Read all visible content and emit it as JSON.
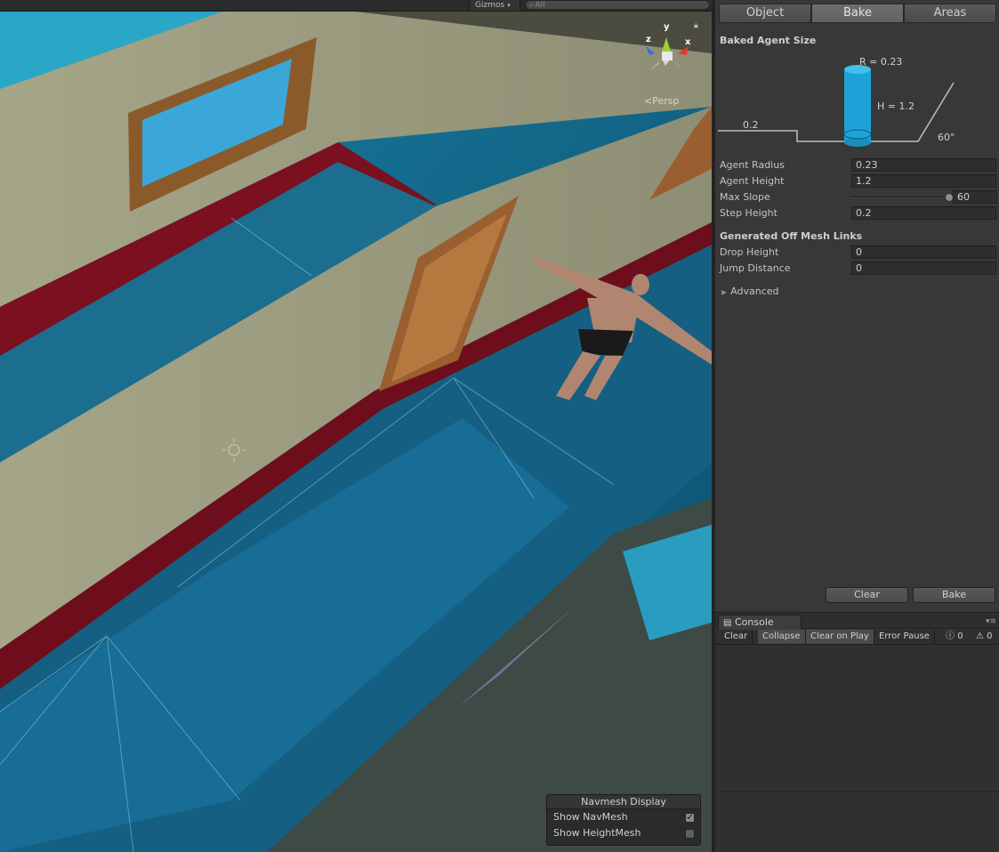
{
  "scene_view": {
    "gizmos_label": "Gizmos",
    "search_placeholder": "All",
    "persp_label": "Persp",
    "gizmo_axes": {
      "x": "x",
      "y": "y",
      "z": "z"
    },
    "navmesh_display": {
      "title": "Navmesh Display",
      "show_navmesh_label": "Show NavMesh",
      "show_navmesh_checked": true,
      "show_heightmesh_label": "Show HeightMesh",
      "show_heightmesh_checked": false
    }
  },
  "navigation": {
    "tabs": [
      "Object",
      "Bake",
      "Areas"
    ],
    "active_tab": "Bake",
    "baked_agent_size": {
      "title": "Baked Agent Size",
      "radius_label": "R = 0.23",
      "height_label": "H = 1.2",
      "step_label": "0.2",
      "slope_label": "60°"
    },
    "fields": [
      {
        "label": "Agent Radius",
        "value": "0.23"
      },
      {
        "label": "Agent Height",
        "value": "1.2"
      },
      {
        "label": "Max Slope",
        "value": "60"
      },
      {
        "label": "Step Height",
        "value": "0.2"
      }
    ],
    "offmesh_title": "Generated Off Mesh Links",
    "offmesh_fields": [
      {
        "label": "Drop Height",
        "value": "0"
      },
      {
        "label": "Jump Distance",
        "value": "0"
      }
    ],
    "advanced_label": "Advanced",
    "clear_button": "Clear",
    "bake_button": "Bake"
  },
  "console": {
    "tab_label": "Console",
    "buttons": [
      "Clear",
      "Collapse",
      "Clear on Play",
      "Error Pause"
    ],
    "error_count": "0",
    "warning_count": "0"
  },
  "colors": {
    "navmesh": "#1aa0c8",
    "wall": "#9c9c80",
    "carpet": "#7a1020",
    "panel_bg": "#383838",
    "agent_cylinder": "#1ea3d8"
  }
}
